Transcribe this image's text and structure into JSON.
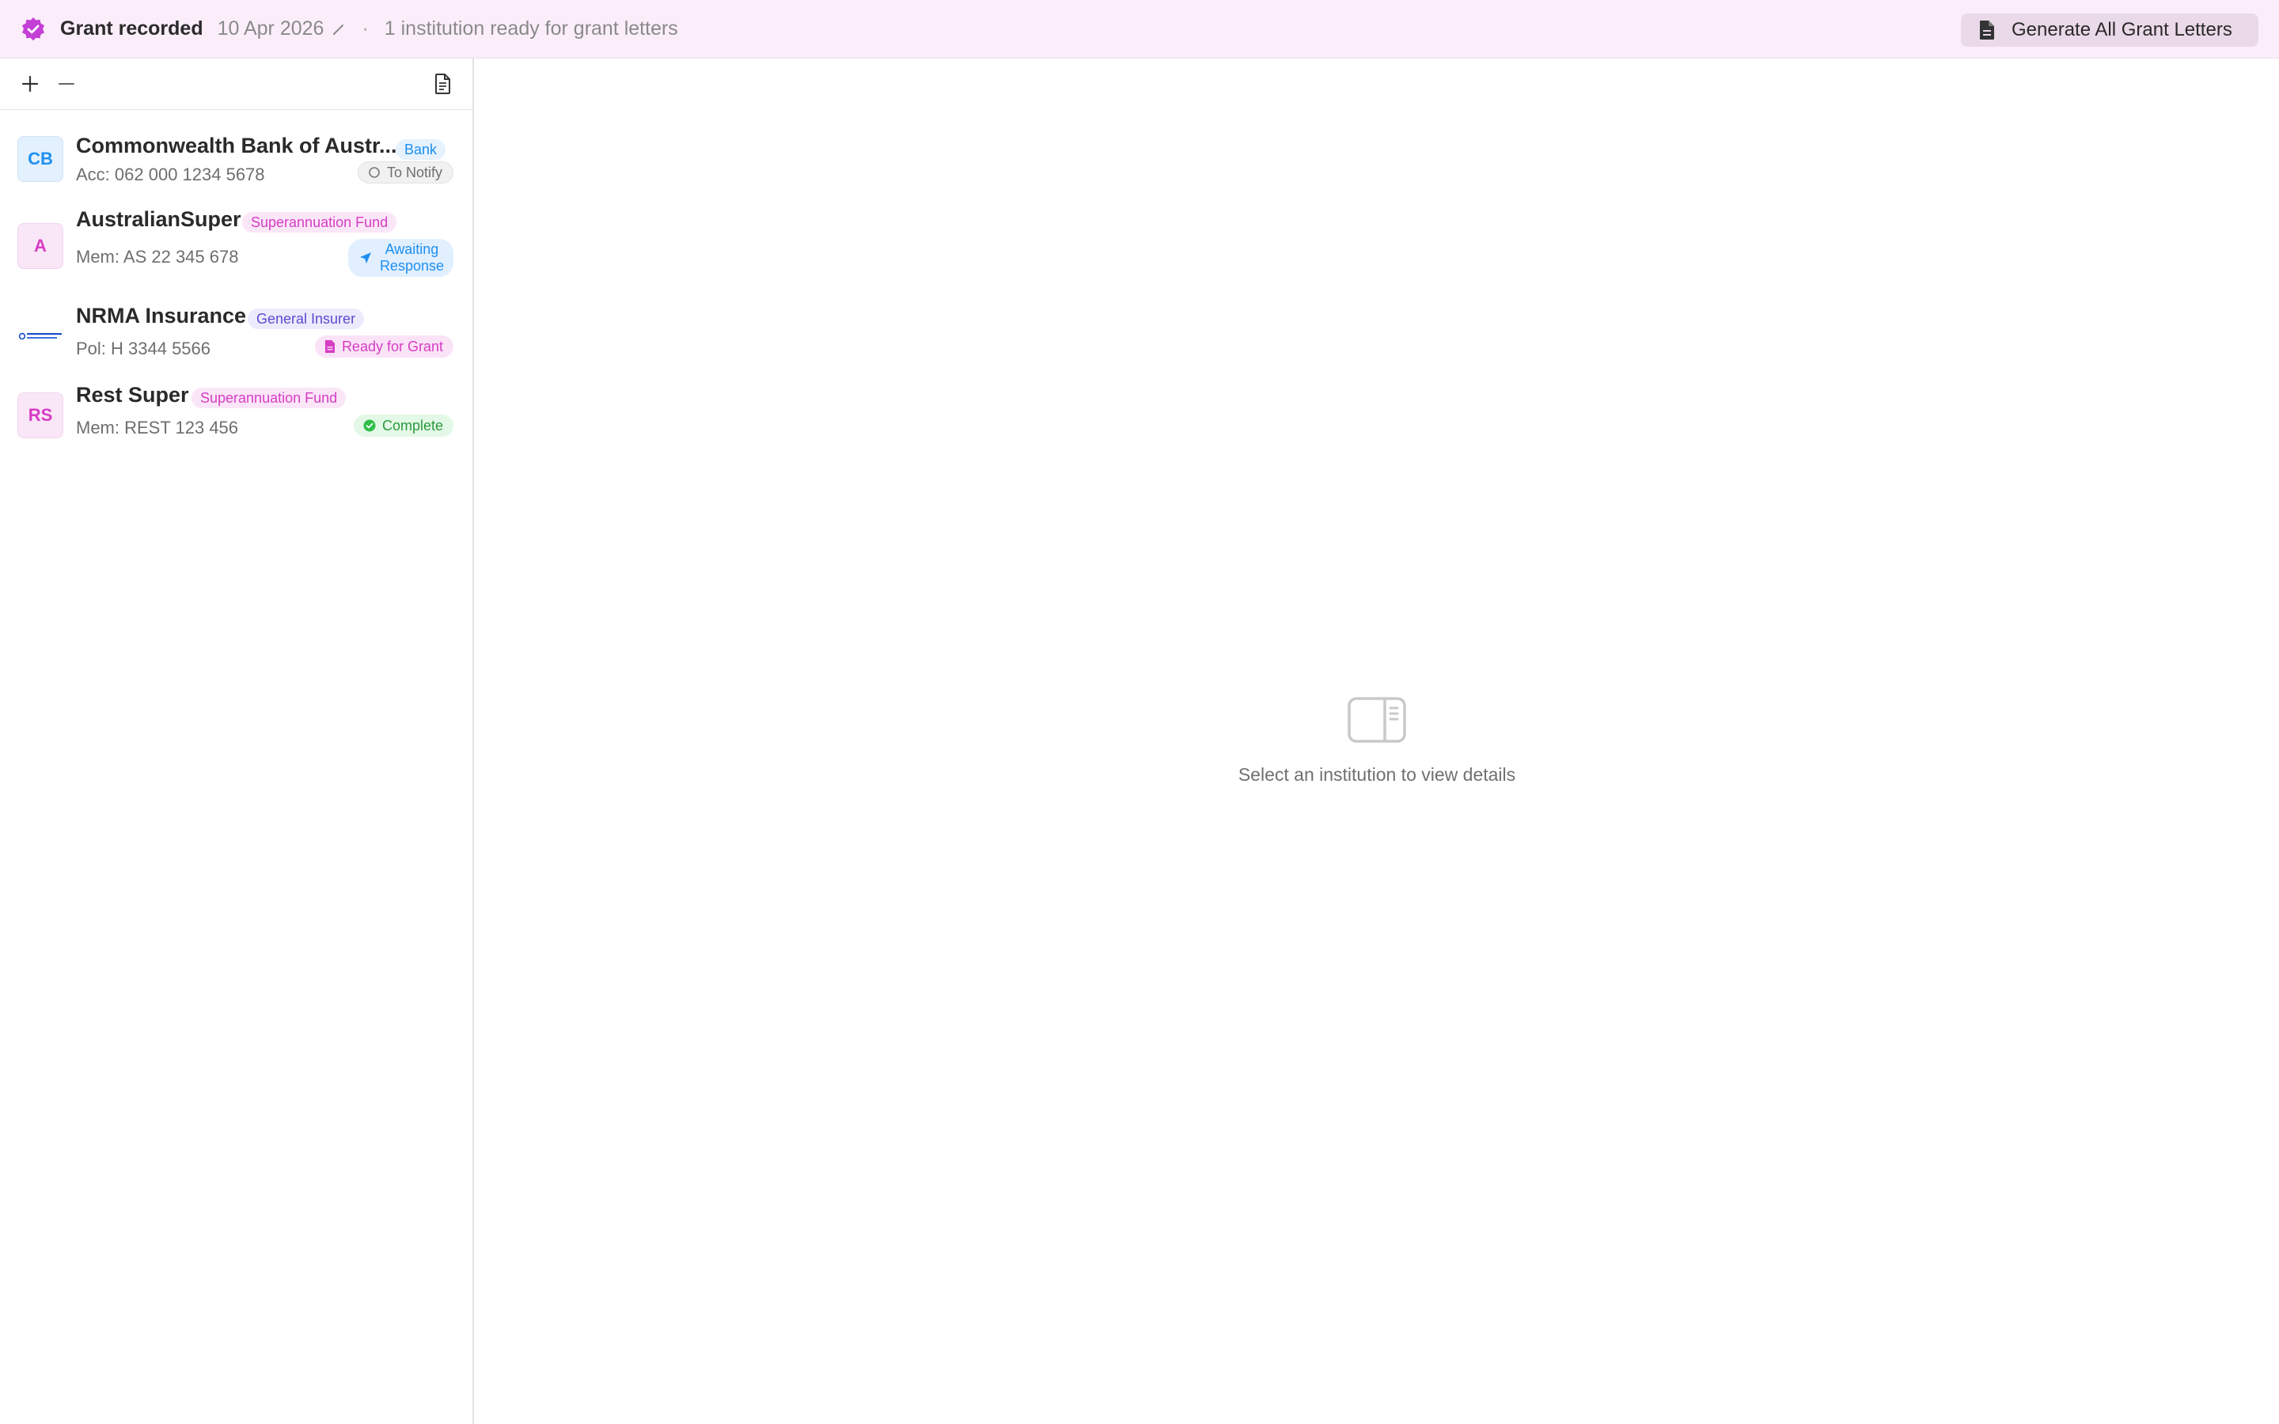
{
  "banner": {
    "title": "Grant recorded",
    "date": "10 Apr 2026",
    "separator": "·",
    "ready_text": "1 institution ready for grant letters",
    "generate_button": "Generate All Grant Letters"
  },
  "institutions": [
    {
      "initials": "CB",
      "name": "Commonwealth Bank of Austr...",
      "type": "Bank",
      "ref": "Acc: 062 000  1234 5678",
      "status": "To Notify"
    },
    {
      "initials": "A",
      "name": "AustralianSuper",
      "type": "Superannuation Fund",
      "ref": "Mem: AS 22 345 678",
      "status_line1": "Awaiting",
      "status_line2": "Response"
    },
    {
      "logo": "nrma-logo",
      "name": "NRMA Insurance",
      "type": "General Insurer",
      "ref": "Pol: H 3344 5566",
      "status": "Ready for Grant"
    },
    {
      "initials": "RS",
      "name": "Rest Super",
      "type": "Superannuation Fund",
      "ref": "Mem: REST 123 456",
      "status": "Complete"
    }
  ],
  "empty_state": {
    "icon": "sidebar-panel-icon",
    "text": "Select an institution to view details"
  },
  "colors": {
    "accent": "#c43fd6",
    "banner_bg": "#fbeefa",
    "bank_blue": "#1f8ff0",
    "super_pink": "#d63cc4",
    "insurer_purple": "#6a5bd6",
    "complete_green": "#2fbf4a"
  }
}
